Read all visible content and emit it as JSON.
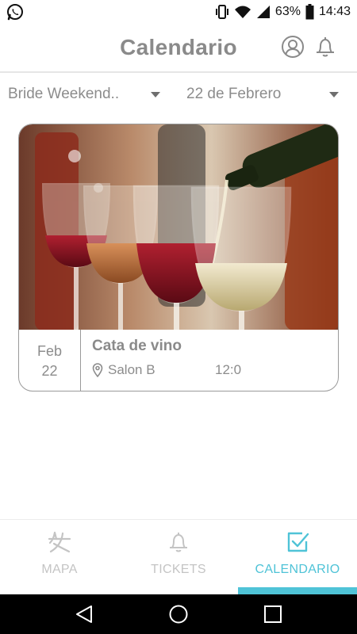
{
  "status_bar": {
    "battery": "63%",
    "time": "14:43",
    "icons": [
      "whatsapp-icon",
      "vibrate-icon",
      "wifi-icon",
      "signal-icon",
      "battery-icon"
    ]
  },
  "header": {
    "title": "Calendario",
    "icons": [
      "profile-icon",
      "bell-icon"
    ]
  },
  "filters": {
    "event": "Bride Weekend..",
    "date": "22 de Febrero"
  },
  "events": [
    {
      "title": "Cata de vino",
      "month": "Feb",
      "day": "22",
      "location": "Salon B",
      "time": "12:0",
      "image": "wine-glasses-photo"
    }
  ],
  "bottom_nav": {
    "tabs": [
      {
        "label": "MAPA",
        "icon": "map-person-icon",
        "active": false
      },
      {
        "label": "TICKETS",
        "icon": "bell-icon",
        "active": false
      },
      {
        "label": "CALENDARIO",
        "icon": "check-square-icon",
        "active": true
      }
    ]
  },
  "colors": {
    "accent": "#4fc3d7",
    "text_muted": "#8c8c8c",
    "tab_inactive": "#c4c4c4"
  }
}
